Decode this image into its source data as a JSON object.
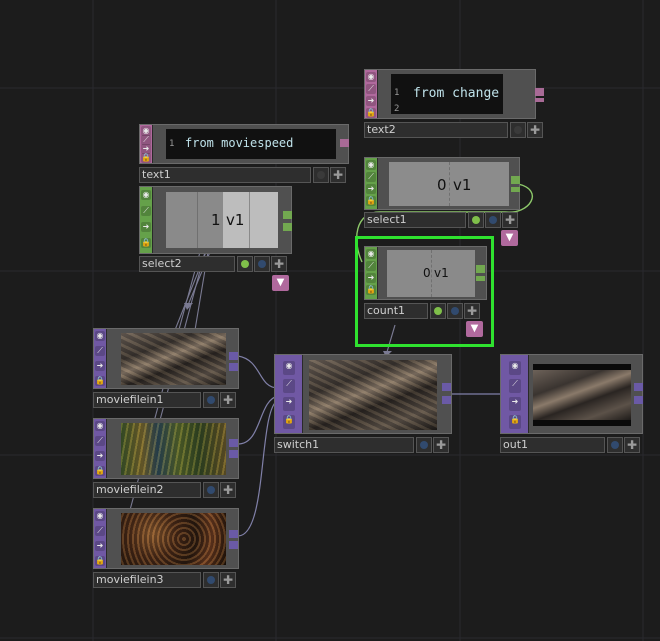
{
  "nodes": {
    "text1": {
      "name": "text1",
      "line_number": "1",
      "content": "from moviespeed"
    },
    "text2": {
      "name": "text2",
      "line_numbers": [
        "1",
        "2"
      ],
      "content": "from change"
    },
    "select2": {
      "name": "select2",
      "value": "1",
      "channel": "v1"
    },
    "select1": {
      "name": "select1",
      "value": "0",
      "channel": "v1"
    },
    "count1": {
      "name": "count1",
      "value": "0",
      "channel": "v1"
    },
    "moviefilein1": {
      "name": "moviefilein1"
    },
    "moviefilein2": {
      "name": "moviefilein2"
    },
    "moviefilein3": {
      "name": "moviefilein3"
    },
    "switch1": {
      "name": "switch1"
    },
    "out1": {
      "name": "out1"
    }
  },
  "icons": {
    "flags": [
      "viewer-flag-icon",
      "display-flag-icon",
      "export-flag-icon",
      "lock-flag-icon"
    ],
    "plus": "✚",
    "arrow": "▼"
  },
  "colors": {
    "selection": "#2fe22f",
    "top_family": "#7058a4",
    "chop_family": "#65a14a",
    "dat_family": "#b0699d",
    "text_color": "#bfe2ea"
  }
}
